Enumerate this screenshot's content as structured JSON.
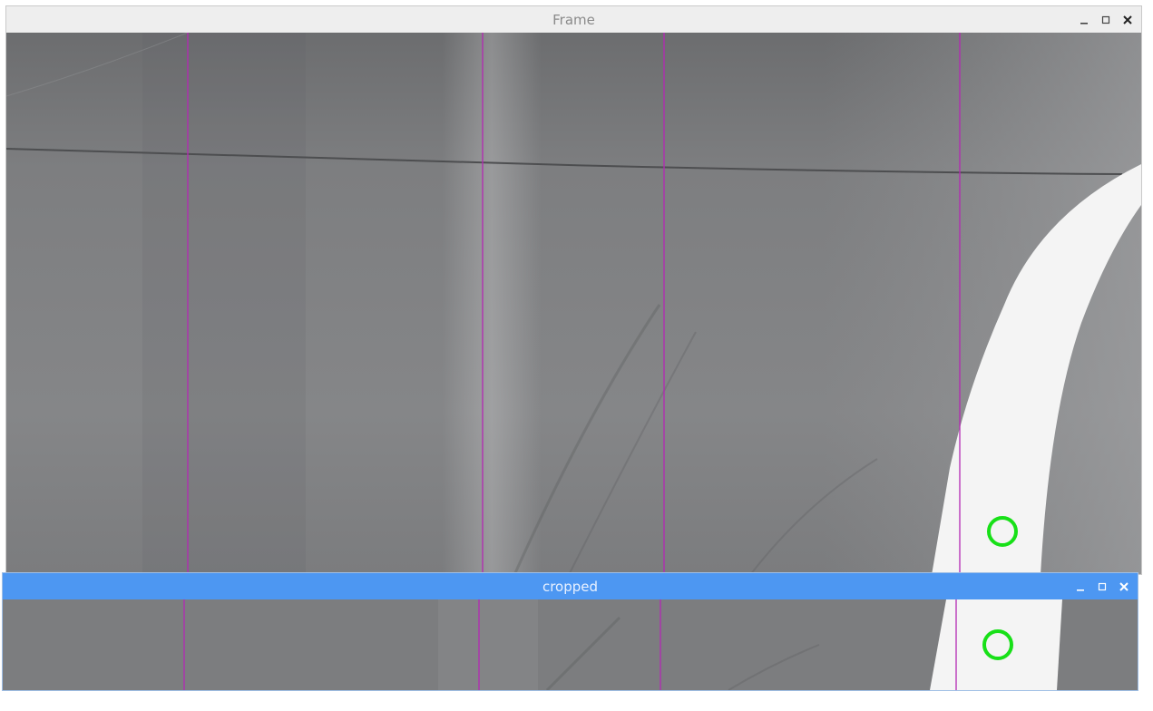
{
  "windows": {
    "frame": {
      "title": "Frame"
    },
    "cropped": {
      "title": "cropped"
    }
  },
  "titlebar_icons": [
    "minimize-icon",
    "maximize-icon",
    "close-icon"
  ],
  "colors": {
    "floor": "#8a8b8d",
    "floor_dark": "#6f7072",
    "lane_line": "#f4f4f4",
    "guide_line": "#b428b4",
    "marker": "#18e018",
    "active_titlebar": "#4d97f2",
    "inactive_titlebar": "#eeeeee"
  },
  "overlay": {
    "guide_line_count": 4,
    "marker_shape": "circle"
  }
}
